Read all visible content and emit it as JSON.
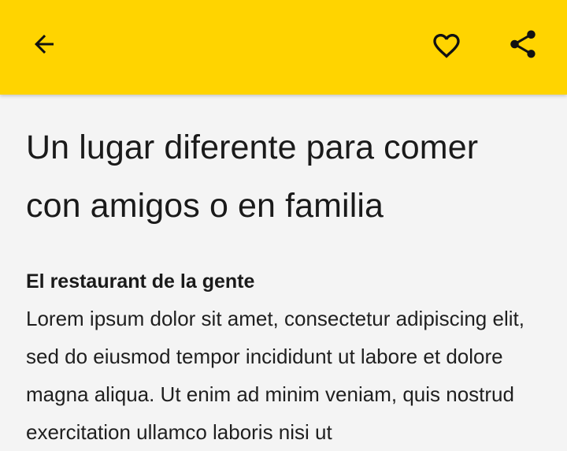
{
  "app_bar": {
    "background_color": "#ffd400",
    "back_icon": "arrow-left-icon",
    "favorite_icon": "heart-outline-icon",
    "share_icon": "share-icon"
  },
  "article": {
    "title": "Un lugar diferente para comer con amigos o en familia",
    "subtitle": "El restaurant de la gente",
    "body": "Lorem ipsum dolor sit amet, consectetur adipiscing elit, sed do eiusmod tempor incididunt ut labore et dolore magna aliqua. Ut enim ad minim veniam, quis nostrud exercitation ullamco laboris nisi ut"
  }
}
